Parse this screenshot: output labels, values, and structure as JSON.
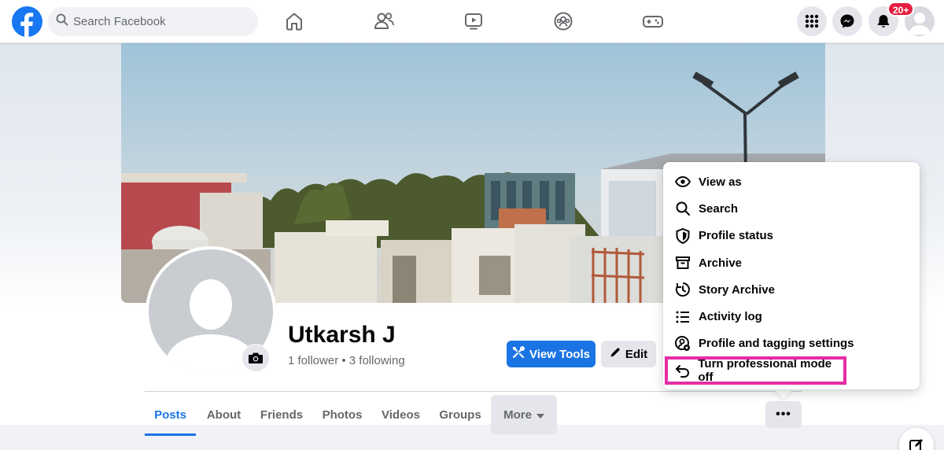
{
  "topbar": {
    "search_placeholder": "Search Facebook",
    "notification_badge": "20+",
    "nav_icons": [
      "home-icon",
      "friends-icon",
      "watch-icon",
      "groups-icon",
      "gaming-icon"
    ],
    "right_icons": [
      "menu-grid-icon",
      "messenger-icon",
      "bell-icon",
      "account-avatar"
    ]
  },
  "profile": {
    "name": "Utkarsh J",
    "stats": "1 follower • 3 following",
    "view_tools_label": "View Tools",
    "edit_label": "Edit"
  },
  "tabs": [
    {
      "label": "Posts",
      "active": true
    },
    {
      "label": "About",
      "active": false
    },
    {
      "label": "Friends",
      "active": false
    },
    {
      "label": "Photos",
      "active": false
    },
    {
      "label": "Videos",
      "active": false
    },
    {
      "label": "Groups",
      "active": false
    },
    {
      "label": "More",
      "active": false
    }
  ],
  "more_options_label": "•••",
  "menu": {
    "items": [
      {
        "label": "View as",
        "icon": "eye-icon"
      },
      {
        "label": "Search",
        "icon": "search-icon"
      },
      {
        "label": "Profile status",
        "icon": "shield-icon"
      },
      {
        "label": "Archive",
        "icon": "archive-icon"
      },
      {
        "label": "Story Archive",
        "icon": "history-icon"
      },
      {
        "label": "Activity log",
        "icon": "list-icon"
      },
      {
        "label": "Profile and tagging settings",
        "icon": "user-gear-icon"
      },
      {
        "label": "Turn professional mode off",
        "icon": "undo-icon",
        "highlighted": true
      }
    ]
  },
  "colors": {
    "brand_blue": "#1877f2",
    "highlight_outline": "#e52ca5",
    "badge_red": "#e41e3f"
  }
}
